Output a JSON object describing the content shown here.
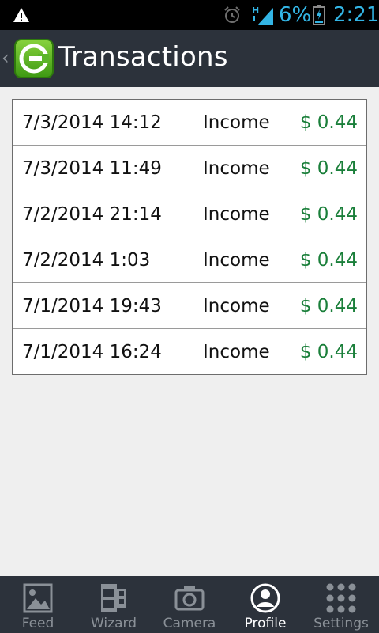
{
  "status_bar": {
    "battery_percent": "6%",
    "time": "2:21",
    "accent_color": "#33b5e5",
    "network_label": "H",
    "icons": [
      "warning-icon",
      "alarm-icon",
      "signal-icon",
      "battery-icon"
    ]
  },
  "action_bar": {
    "title": "Transactions",
    "logo_icon": "app-logo-c-icon"
  },
  "transactions": [
    {
      "date": "7/3/2014 14:12",
      "type": "Income",
      "amount": "$ 0.44"
    },
    {
      "date": "7/3/2014 11:49",
      "type": "Income",
      "amount": "$ 0.44"
    },
    {
      "date": "7/2/2014 21:14",
      "type": "Income",
      "amount": "$ 0.44"
    },
    {
      "date": "7/2/2014 1:03",
      "type": "Income",
      "amount": "$ 0.44"
    },
    {
      "date": "7/1/2014 19:43",
      "type": "Income",
      "amount": "$ 0.44"
    },
    {
      "date": "7/1/2014 16:24",
      "type": "Income",
      "amount": "$ 0.44"
    }
  ],
  "bottom_nav": {
    "items": [
      {
        "label": "Feed",
        "icon": "image-icon",
        "active": false
      },
      {
        "label": "Wizard",
        "icon": "film-icon",
        "active": false
      },
      {
        "label": "Camera",
        "icon": "camera-icon",
        "active": false
      },
      {
        "label": "Profile",
        "icon": "user-icon",
        "active": true
      },
      {
        "label": "Settings",
        "icon": "grid-dots-icon",
        "active": false
      }
    ]
  },
  "colors": {
    "bar_background": "#2c323b",
    "amount_green": "#1a7f3a",
    "page_background": "#efefef"
  }
}
